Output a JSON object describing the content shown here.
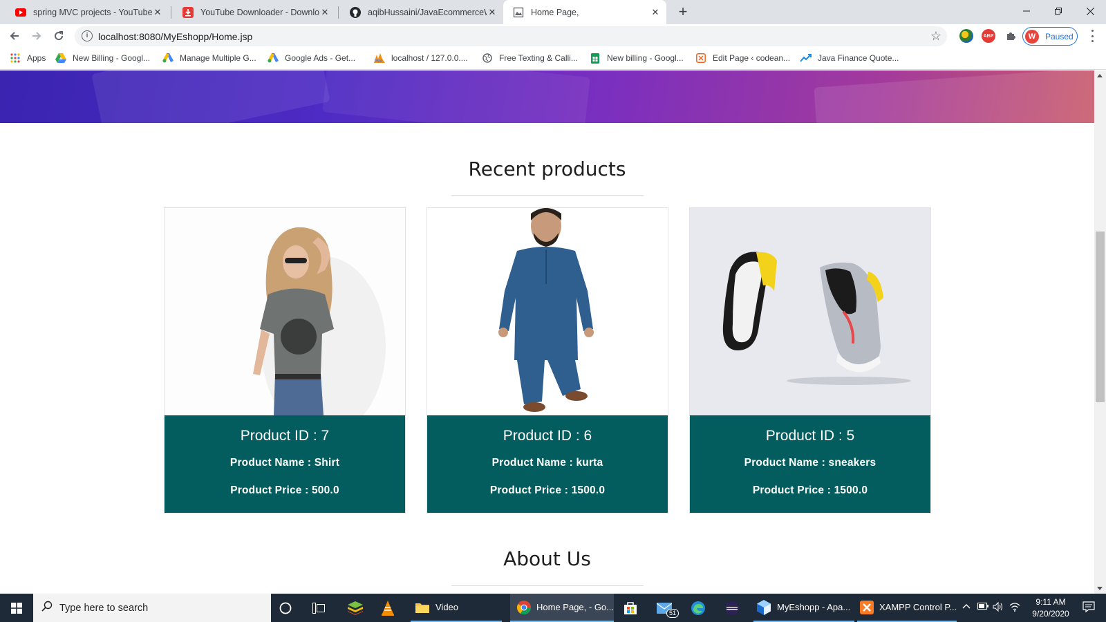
{
  "browser": {
    "tabs": [
      {
        "title": "spring MVC projects - YouTube",
        "icon": "youtube-icon"
      },
      {
        "title": "YouTube Downloader - Downloa",
        "icon": "downloader-icon"
      },
      {
        "title": "aqibHussaini/JavaEcommerceWe",
        "icon": "github-icon"
      },
      {
        "title": "Home Page,",
        "icon": "page-icon",
        "active": true
      }
    ],
    "url": "localhost:8080/MyEshopp/Home.jsp",
    "profile": {
      "initial": "W",
      "label": "Paused"
    },
    "bookmarks": [
      {
        "label": "Apps",
        "icon": "apps-grid-icon"
      },
      {
        "label": "New Billing - Googl...",
        "icon": "google-drive-icon"
      },
      {
        "label": "Manage Multiple G...",
        "icon": "google-ads-icon"
      },
      {
        "label": "Google Ads - Get...",
        "icon": "google-ads-icon"
      },
      {
        "label": "localhost / 127.0.0....",
        "icon": "phpmyadmin-icon"
      },
      {
        "label": "Free Texting & Calli...",
        "icon": "globe-icon"
      },
      {
        "label": "New billing - Googl...",
        "icon": "google-sheets-icon"
      },
      {
        "label": "Edit Page ‹ codean...",
        "icon": "codeanywhere-icon"
      },
      {
        "label": "Java Finance Quote...",
        "icon": "chart-trend-icon"
      }
    ]
  },
  "page": {
    "recent_title": "Recent products",
    "about_title": "About Us",
    "products": [
      {
        "id_text": "Product ID : 7",
        "name_text": "Product Name : Shirt",
        "price_text": "Product Price : 500.0",
        "image": "woman-in-grey-tshirt"
      },
      {
        "id_text": "Product ID : 6",
        "name_text": "Product Name : kurta",
        "price_text": "Product Price : 1500.0",
        "image": "man-in-blue-kurta"
      },
      {
        "id_text": "Product ID : 5",
        "name_text": "Product Name : sneakers",
        "price_text": "Product Price : 1500.0",
        "image": "grey-yellow-sneakers"
      }
    ]
  },
  "taskbar": {
    "search_placeholder": "Type here to search",
    "items": [
      {
        "label": "Video",
        "icon": "file-explorer-icon"
      },
      {
        "label": "Home Page, - Go...",
        "icon": "chrome-icon"
      },
      {
        "label": "MyEshopp - Apa...",
        "icon": "netbeans-icon"
      },
      {
        "label": "XAMPP Control P...",
        "icon": "xampp-icon"
      }
    ],
    "mail_badge": "51",
    "time": "9:11 AM",
    "date": "9/20/2020"
  },
  "colors": {
    "card_info_bg": "#035d5f",
    "taskbar_bg": "#1f2a38",
    "profile_accent": "#1a73e8",
    "banner_gradient": [
      "#3a24b0",
      "#7a2fbf",
      "#c95a6a"
    ]
  }
}
